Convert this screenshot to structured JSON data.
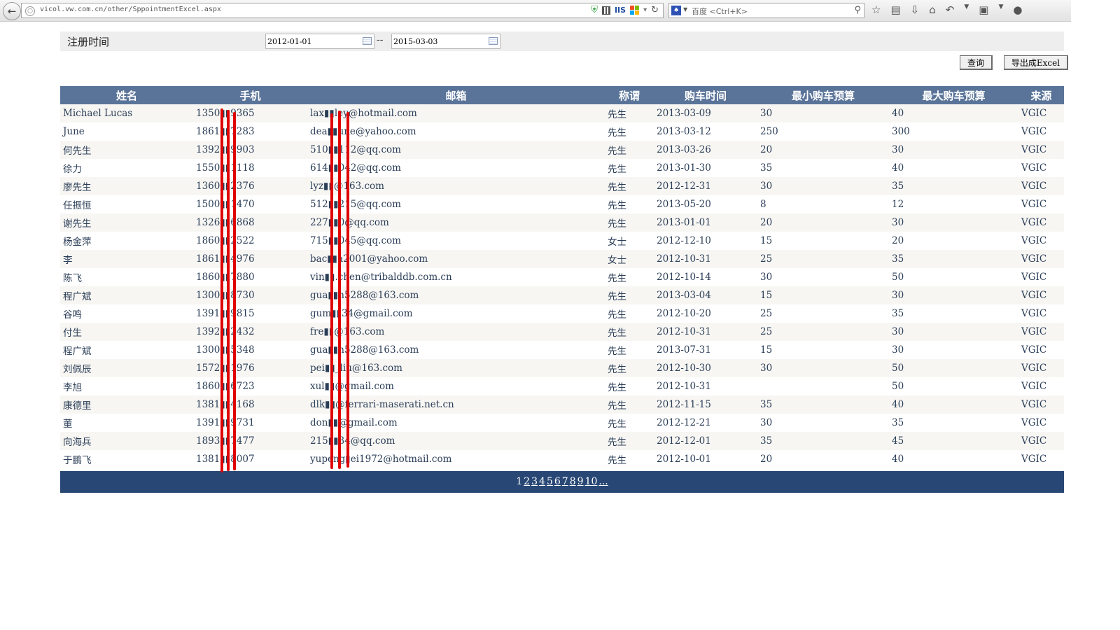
{
  "browser": {
    "url": "vicol.vw.com.cn/other/SppointmentExcel.aspx",
    "search_placeholder": "百度 <Ctrl+K>",
    "iis_badge": "IIS"
  },
  "filter": {
    "label": "注册时间",
    "start_date": "2012-01-01",
    "separator": "--",
    "end_date": "2015-03-03"
  },
  "buttons": {
    "query": "查询",
    "export": "导出成Excel"
  },
  "table": {
    "headers": [
      "姓名",
      "手机",
      "邮箱",
      "称谓",
      "购车时间",
      "最小购车预算",
      "最大购车预算",
      "来源"
    ],
    "rows": [
      [
        "Michael Lucas",
        "1350▮▮9365",
        "lax▮▮ley@hotmail.com",
        "先生",
        "2013-03-09",
        "30",
        "40",
        "VGIC"
      ],
      [
        "June",
        "1861▮▮7283",
        "dea▮▮une@yahoo.com",
        "先生",
        "2013-03-12",
        "250",
        "300",
        "VGIC"
      ],
      [
        "何先生",
        "1392▮▮9903",
        "510▮▮112@qq.com",
        "先生",
        "2013-03-26",
        "20",
        "30",
        "VGIC"
      ],
      [
        "徐力",
        "1550▮▮1118",
        "614▮▮042@qq.com",
        "先生",
        "2013-01-30",
        "35",
        "40",
        "VGIC"
      ],
      [
        "廖先生",
        "1360▮▮2376",
        "lyz▮▮@163.com",
        "先生",
        "2012-12-31",
        "30",
        "35",
        "VGIC"
      ],
      [
        "任振恒",
        "1500▮▮1470",
        "512▮▮215@qq.com",
        "先生",
        "2013-05-20",
        "8",
        "12",
        "VGIC"
      ],
      [
        "谢先生",
        "1326▮▮6868",
        "227▮▮0@qq.com",
        "先生",
        "2013-01-01",
        "20",
        "30",
        "VGIC"
      ],
      [
        "杨金萍",
        "1860▮▮2522",
        "715▮▮045@qq.com",
        "女士",
        "2012-12-10",
        "15",
        "20",
        "VGIC"
      ],
      [
        "李",
        "1861▮▮4976",
        "bac▮▮a2001@yahoo.com",
        "女士",
        "2012-10-31",
        "25",
        "35",
        "VGIC"
      ],
      [
        "陈飞",
        "1860▮▮7880",
        "vin▮▮.chen@tribalddb.com.cn",
        "先生",
        "2012-10-14",
        "30",
        "50",
        "VGIC"
      ],
      [
        "程广斌",
        "1300▮▮8730",
        "gua▮▮n5288@163.com",
        "先生",
        "2013-03-04",
        "15",
        "30",
        "VGIC"
      ],
      [
        "谷鸣",
        "1391▮▮9815",
        "gum▮▮34@gmail.com",
        "先生",
        "2012-10-20",
        "25",
        "35",
        "VGIC"
      ],
      [
        "付生",
        "1392▮▮2432",
        "fre▮▮@163.com",
        "先生",
        "2012-10-31",
        "25",
        "30",
        "VGIC"
      ],
      [
        "程广斌",
        "1300▮▮5348",
        "gua▮▮n5288@163.com",
        "先生",
        "2013-07-31",
        "15",
        "30",
        "VGIC"
      ],
      [
        "刘佩辰",
        "1572▮▮1976",
        "pei▮▮_liu@163.com",
        "先生",
        "2012-10-30",
        "30",
        "50",
        "VGIC"
      ],
      [
        "李旭",
        "1860▮▮6723",
        "xul▮▮@gmail.com",
        "先生",
        "2012-10-31",
        "",
        "50",
        "VGIC"
      ],
      [
        "康德里",
        "1381▮▮4168",
        "dlk▮▮@ferrari-maserati.net.cn",
        "先生",
        "2012-11-15",
        "35",
        "40",
        "VGIC"
      ],
      [
        "董",
        "1391▮▮9731",
        "don▮▮@gmail.com",
        "先生",
        "2012-12-21",
        "30",
        "35",
        "VGIC"
      ],
      [
        "向海兵",
        "1893▮▮7477",
        "215▮▮34@qq.com",
        "先生",
        "2012-12-01",
        "35",
        "45",
        "VGIC"
      ],
      [
        "于鹏飞",
        "1381▮▮8007",
        "yupeng▮ei1972@hotmail.com",
        "先生",
        "2012-10-01",
        "20",
        "40",
        "VGIC"
      ]
    ]
  },
  "pager": {
    "current": "1",
    "pages": [
      "2",
      "3",
      "4",
      "5",
      "6",
      "7",
      "8",
      "9",
      "10",
      "..."
    ]
  },
  "colors": {
    "header_bg": "#5a7499",
    "pager_bg": "#284775",
    "redaction": "#e00000"
  }
}
